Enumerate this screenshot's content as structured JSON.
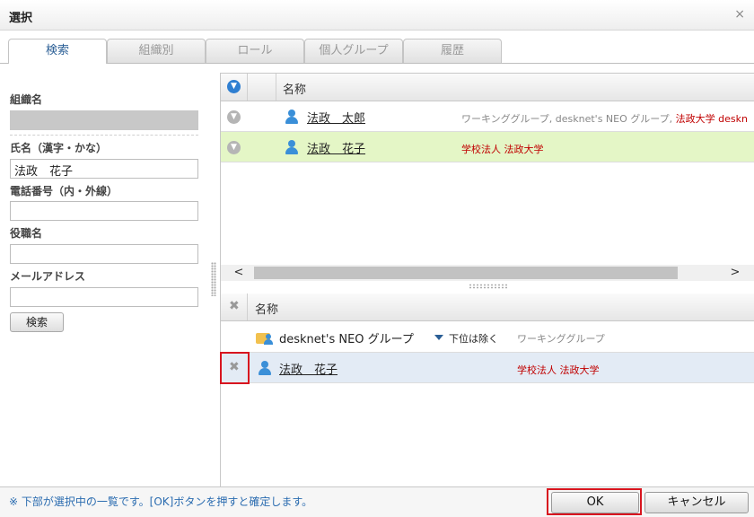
{
  "dialog": {
    "title": "選択",
    "close_icon": "×"
  },
  "tabs": [
    "検索",
    "組織別",
    "ロール",
    "個人グループ",
    "履歴"
  ],
  "search_form": {
    "org_label": "組織名",
    "name_label": "氏名（漢字・かな）",
    "name_value": "法政　花子",
    "phone_label": "電話番号（内・外線）",
    "phone_value": "",
    "title_label": "役職名",
    "title_value": "",
    "email_label": "メールアドレス",
    "email_value": "",
    "search_button": "検索"
  },
  "results": {
    "header_name": "名称",
    "select_all_icon": "double-chevron-down-icon",
    "rows": [
      {
        "name": "法政　太郎",
        "orgs_grey": "ワーキンググループ, desknet's NEO グループ,",
        "orgs_red": "法政大学 deskn"
      },
      {
        "name": "法政　花子",
        "orgs_grey": "",
        "orgs_red": "学校法人 法政大学"
      }
    ],
    "scroll_left": "<",
    "scroll_right": ">"
  },
  "selected": {
    "header_name": "名称",
    "rows": [
      {
        "name": "desknet's NEO グループ",
        "option": "下位は除く",
        "category": "ワーキンググループ"
      },
      {
        "name": "法政　花子",
        "org": "学校法人 法政大学"
      }
    ]
  },
  "footer": {
    "note": "※ 下部が選択中の一覧です。[OK]ボタンを押すと確定します。",
    "ok_button": "OK",
    "cancel_button": "キャンセル"
  },
  "colors": {
    "highlight": "#d8151f",
    "selected_green": "#e4f6c6",
    "selected_blue": "#e3ebf5",
    "accent": "#2f7fd1"
  }
}
